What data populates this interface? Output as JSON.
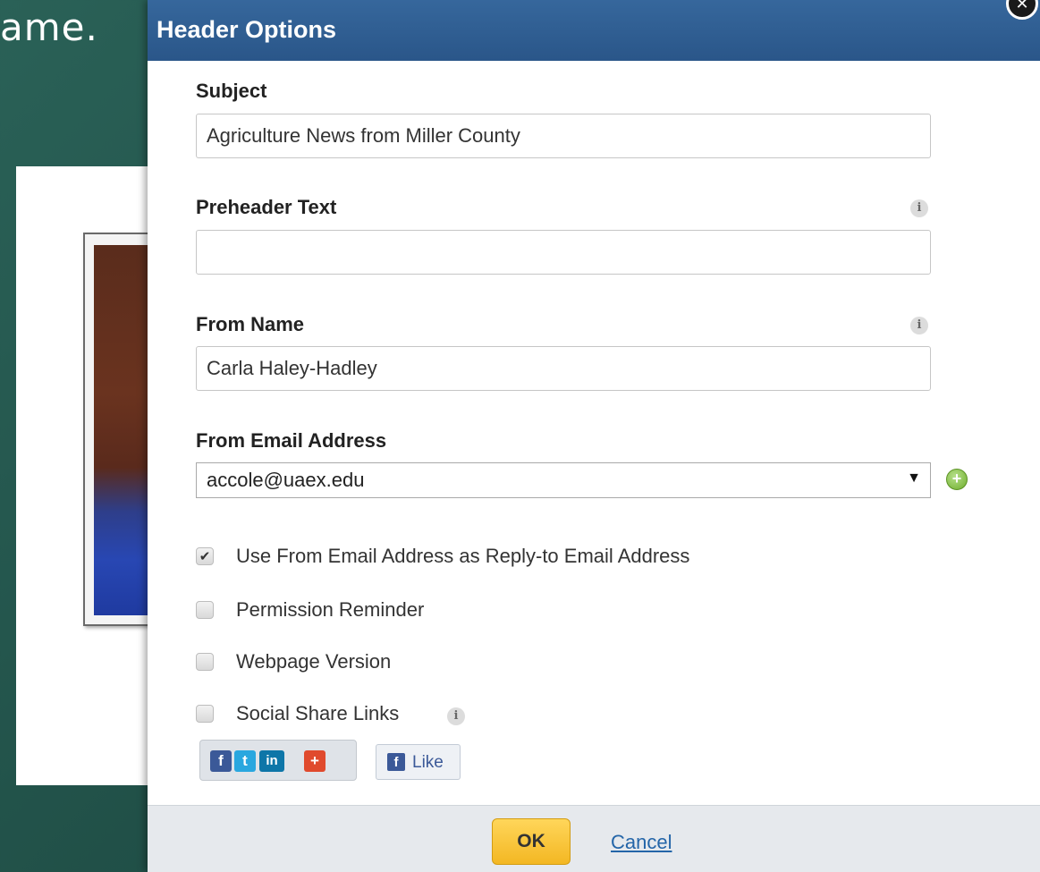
{
  "background": {
    "slide_text": "ame."
  },
  "dialog": {
    "title": "Header Options",
    "fields": {
      "subject": {
        "label": "Subject",
        "value": "Agriculture News from Miller County"
      },
      "preheader": {
        "label": "Preheader Text",
        "value": ""
      },
      "from_name": {
        "label": "From Name",
        "value": "Carla Haley-Hadley"
      },
      "from_email": {
        "label": "From Email Address",
        "selected": "accole@uaex.edu"
      }
    },
    "info_glyph": "i",
    "options": [
      {
        "label": "Use From Email Address as Reply-to Email Address",
        "checked": true
      },
      {
        "label": "Permission Reminder",
        "checked": false
      },
      {
        "label": "Webpage Version",
        "checked": false
      },
      {
        "label": "Social Share Links",
        "checked": false
      }
    ],
    "social": {
      "buttons": [
        {
          "icon": "facebook-icon",
          "glyph": "f",
          "color": "#3b5998"
        },
        {
          "icon": "twitter-icon",
          "glyph": "t",
          "color": "#29a7df"
        },
        {
          "icon": "linkedin-icon",
          "glyph": "in",
          "color": "#0e76a8"
        },
        {
          "icon": "google-plus-icon",
          "glyph": "+",
          "color": "#e04a2d"
        }
      ],
      "like_label": "Like"
    },
    "footer": {
      "ok_label": "OK",
      "cancel_label": "Cancel"
    }
  },
  "colors": {
    "header_bg": "#2f5f93",
    "ok_button": "#f6c02f",
    "link": "#2465a8"
  }
}
